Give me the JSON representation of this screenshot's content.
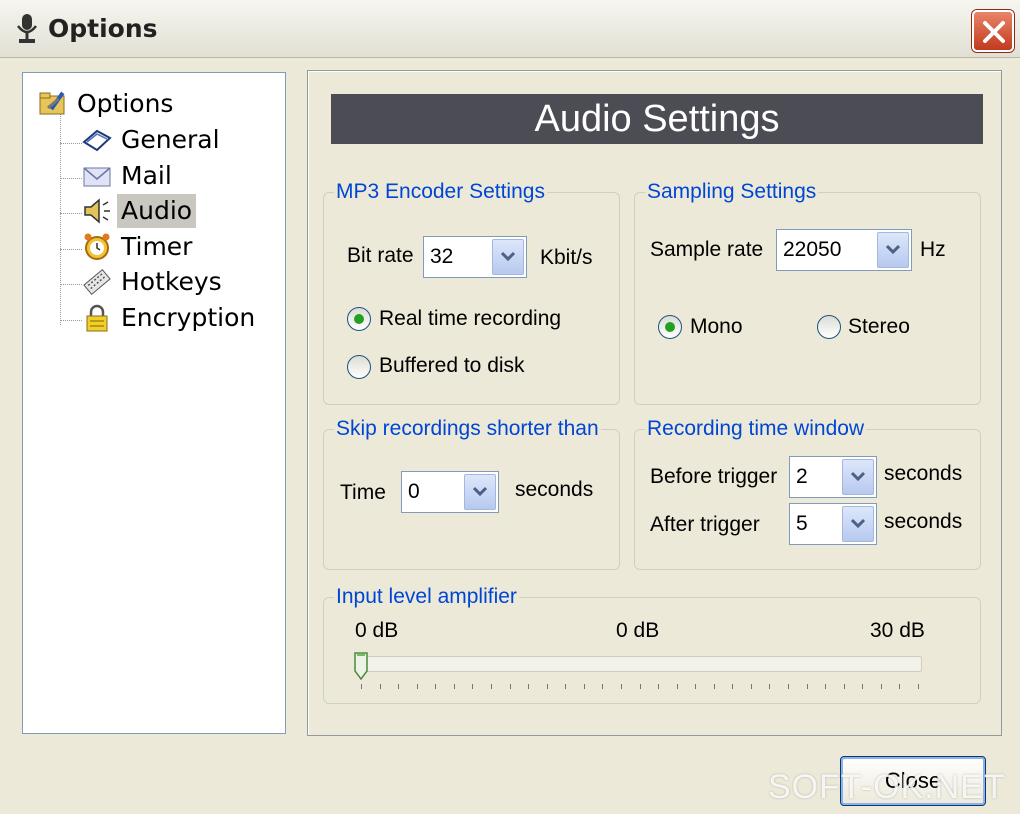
{
  "window": {
    "title": "Options"
  },
  "tree": {
    "root": "Options",
    "items": [
      {
        "label": "General",
        "icon": "book-icon"
      },
      {
        "label": "Mail",
        "icon": "envelope-icon"
      },
      {
        "label": "Audio",
        "icon": "speaker-icon",
        "selected": true
      },
      {
        "label": "Timer",
        "icon": "alarm-clock-icon"
      },
      {
        "label": "Hotkeys",
        "icon": "keyboard-icon"
      },
      {
        "label": "Encryption",
        "icon": "lock-icon"
      }
    ]
  },
  "header": {
    "title": "Audio Settings"
  },
  "mp3": {
    "legend": "MP3 Encoder Settings",
    "bitrate_label": "Bit rate",
    "bitrate_value": "32",
    "bitrate_unit": "Kbit/s",
    "radio_realtime": "Real time recording",
    "radio_buffered": "Buffered to disk",
    "selected": "realtime"
  },
  "sampling": {
    "legend": "Sampling Settings",
    "rate_label": "Sample rate",
    "rate_value": "22050",
    "rate_unit": "Hz",
    "radio_mono": "Mono",
    "radio_stereo": "Stereo",
    "selected": "mono"
  },
  "skip": {
    "legend": "Skip recordings shorter than",
    "time_label": "Time",
    "time_value": "0",
    "time_unit": "seconds"
  },
  "window_group": {
    "legend": "Recording time window",
    "before_label": "Before trigger",
    "before_value": "2",
    "before_unit": "seconds",
    "after_label": "After trigger",
    "after_value": "5",
    "after_unit": "seconds"
  },
  "amplifier": {
    "legend": "Input level amplifier",
    "min_label": "0 dB",
    "current_label": "0 dB",
    "max_label": "30 dB",
    "level_fraction": 0
  },
  "footer": {
    "close_label": "Close"
  },
  "watermark": {
    "text": "SOFT-OK.NET"
  }
}
